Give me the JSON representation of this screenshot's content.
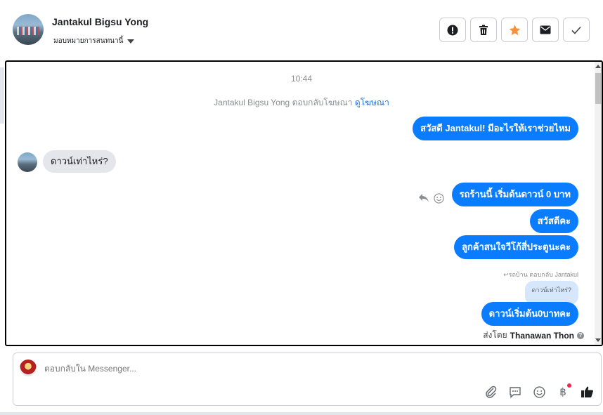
{
  "header": {
    "contact_name": "Jantakul Bigsu Yong",
    "assign_label": "มอบหมายการสนทนานี้",
    "actions": [
      {
        "name": "report-spam-button",
        "icon": "alert-icon"
      },
      {
        "name": "delete-button",
        "icon": "trash-icon"
      },
      {
        "name": "star-button",
        "icon": "star-icon"
      },
      {
        "name": "mark-unread-button",
        "icon": "envelope-icon"
      },
      {
        "name": "mark-done-button",
        "icon": "check-icon"
      }
    ]
  },
  "conversation": {
    "timestamp": "10:44",
    "ad_reply_text": "Jantakul Bigsu Yong ตอบกลับโฆษณา",
    "ad_link": "ดูโฆษณา",
    "messages": {
      "m1": "สวัสดี Jantakul! มีอะไรให้เราช่วยไหม",
      "m2": "ดาวน์เท่าไหร่?",
      "m3": "รถร้านนี้ เริ่มต้นดาวน์ 0 บาท",
      "m4": "สวัสดีคะ",
      "m5": "ลูกค้าสนใจวีโก้สี่ประตูนะคะ",
      "reply_meta": "รถบ้าน ตอบกลับ Jantakul",
      "quoted": "ดาวน์เท่าไหร่?",
      "m6": "ดาวน์เริ่มต้น0บาทคะ"
    },
    "sent_by_prefix": "ส่งโดย",
    "sent_by_name": "Thanawan Thon"
  },
  "composer": {
    "placeholder": "ตอบกลับใน Messenger..."
  },
  "colors": {
    "accent": "#0a7cff",
    "star": "#f7923b",
    "notification_dot": "#f02849"
  }
}
